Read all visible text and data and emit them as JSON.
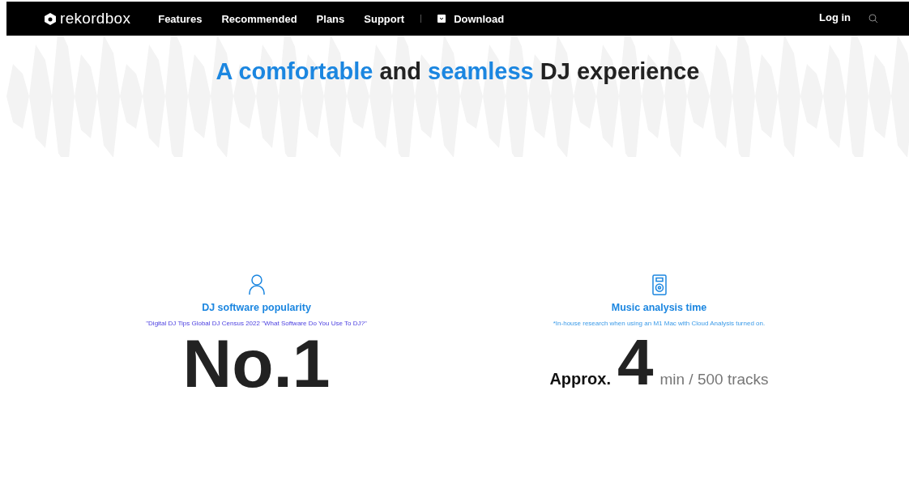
{
  "nav": {
    "logo": "rekordbox",
    "links": [
      {
        "label": "Features"
      },
      {
        "label": "Recommended"
      },
      {
        "label": "Plans"
      },
      {
        "label": "Support"
      }
    ],
    "download": "Download",
    "login": "Log in"
  },
  "headline": [
    {
      "text": "A comfortable",
      "highlight": true
    },
    {
      "text": " and ",
      "highlight": false
    },
    {
      "text": "seamless",
      "highlight": true
    },
    {
      "text": " DJ experience",
      "highlight": false
    }
  ],
  "stats": [
    {
      "kind": "popularity",
      "title": "DJ software popularity",
      "note": "\"Digital DJ Tips Global DJ Census 2022 \"What Software Do You Use To DJ?\"",
      "value": "No.1"
    },
    {
      "kind": "time",
      "title": "Music analysis time",
      "note": "*In-house research when using an M1 Mac with Cloud Analysis turned on.",
      "prefix": "Approx.",
      "value": "4",
      "suffix": "min / 500 tracks"
    }
  ]
}
